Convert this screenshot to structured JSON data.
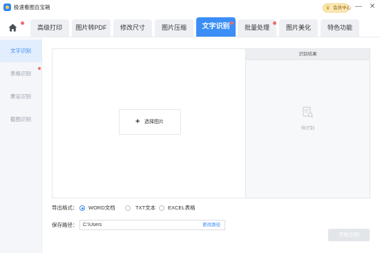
{
  "app": {
    "title": "极速看图百宝箱",
    "vip_label": "会员中心",
    "window_controls": {
      "minimize": "—",
      "close": "✕"
    }
  },
  "tabs": [
    {
      "label": "高级打印",
      "active": false
    },
    {
      "label": "图片转PDF",
      "active": false
    },
    {
      "label": "修改尺寸",
      "active": false
    },
    {
      "label": "图片压缩",
      "active": false
    },
    {
      "label": "文字识别",
      "active": true
    },
    {
      "label": "批量处理",
      "active": false
    },
    {
      "label": "图片美化",
      "active": false
    },
    {
      "label": "特色功能",
      "active": false
    }
  ],
  "sidebar": {
    "items": [
      {
        "label": "文字识别",
        "active": true
      },
      {
        "label": "表格识别",
        "active": false
      },
      {
        "label": "票证识别",
        "active": false
      },
      {
        "label": "截图识别",
        "active": false
      }
    ]
  },
  "main": {
    "select_image_label": "选择图片",
    "result_header": "识别结果",
    "result_placeholder": "待识别"
  },
  "export": {
    "label": "导出格式：",
    "options": [
      {
        "label": "WORD文档",
        "checked": true
      },
      {
        "label": "TXT文本",
        "checked": false
      },
      {
        "label": "EXCEL表格",
        "checked": false
      }
    ]
  },
  "save": {
    "label": "保存路径：",
    "path": "C:\\Users",
    "change_label": "更改路径"
  },
  "start_button": "开始识别",
  "colors": {
    "accent": "#3a8ef6",
    "notify_dot": "#f26a6a",
    "sidebar_bg": "#f4f6f9"
  }
}
